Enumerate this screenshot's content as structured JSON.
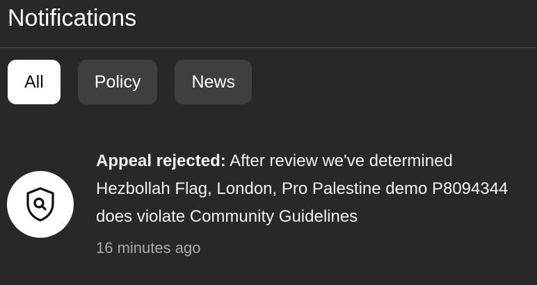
{
  "header": {
    "title": "Notifications"
  },
  "filters": [
    {
      "label": "All",
      "active": true
    },
    {
      "label": "Policy",
      "active": false
    },
    {
      "label": "News",
      "active": false
    }
  ],
  "notification": {
    "icon": "shield-search-icon",
    "lead": "Appeal rejected:",
    "message": "After review we've determined Hezbollah Flag, London, Pro Palestine demo P8094344 does violate Community Guidelines",
    "time": "16 minutes ago"
  },
  "colors": {
    "background": "#282828",
    "chip": "#3f3f3f",
    "chip_active": "#ffffff",
    "secondary_text": "#aaaaaa"
  }
}
